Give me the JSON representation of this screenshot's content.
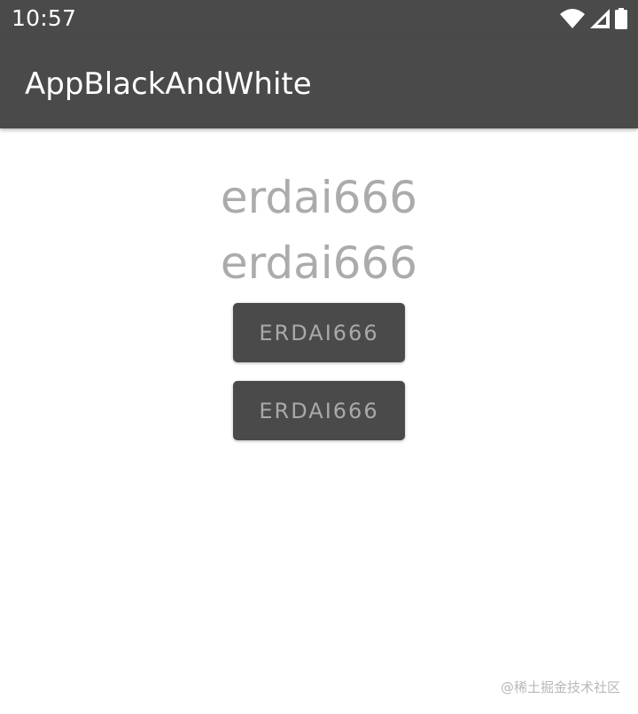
{
  "status_bar": {
    "time": "10:57",
    "icons": [
      "wifi-icon",
      "cell-signal-icon",
      "battery-icon"
    ]
  },
  "app_bar": {
    "title": "AppBlackAndWhite"
  },
  "main": {
    "text_views": [
      "erdai666",
      "erdai666"
    ],
    "buttons": [
      "ERDAI666",
      "ERDAI666"
    ]
  },
  "watermark": "@稀土掘金技术社区",
  "colors": {
    "bar_background": "#4a4a4a",
    "page_background": "#ffffff",
    "text_gray": "#ababab",
    "button_background": "#4a4a4a",
    "button_text": "#a9a9a9"
  }
}
